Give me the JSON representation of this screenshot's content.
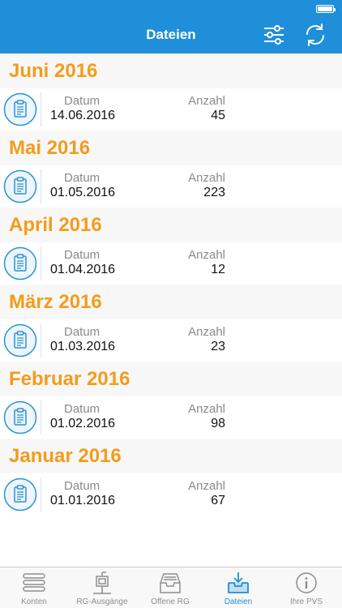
{
  "colors": {
    "primary": "#1f8fd9",
    "accent": "#f39c1b",
    "tab_inactive": "#8e8e8e"
  },
  "nav": {
    "title": "Dateien",
    "filter_icon": "sliders-icon",
    "refresh_icon": "refresh-icon"
  },
  "list": {
    "label_datum": "Datum",
    "label_anzahl": "Anzahl",
    "sections": [
      {
        "title": "Juni 2016",
        "datum": "14.06.2016",
        "anzahl": "45"
      },
      {
        "title": "Mai 2016",
        "datum": "01.05.2016",
        "anzahl": "223"
      },
      {
        "title": "April 2016",
        "datum": "01.04.2016",
        "anzahl": "12"
      },
      {
        "title": "März 2016",
        "datum": "01.03.2016",
        "anzahl": "23"
      },
      {
        "title": "Februar 2016",
        "datum": "01.02.2016",
        "anzahl": "98"
      },
      {
        "title": "Januar 2016",
        "datum": "01.01.2016",
        "anzahl": "67"
      }
    ]
  },
  "tabs": [
    {
      "label": "Konten",
      "icon": "stack-icon",
      "active": false
    },
    {
      "label": "RG-Ausgänge",
      "icon": "mailbox-icon",
      "active": false
    },
    {
      "label": "Offene RG",
      "icon": "tray-icon",
      "active": false
    },
    {
      "label": "Dateien",
      "icon": "download-tray-icon",
      "active": true
    },
    {
      "label": "Ihre PVS",
      "icon": "info-icon",
      "active": false
    }
  ]
}
